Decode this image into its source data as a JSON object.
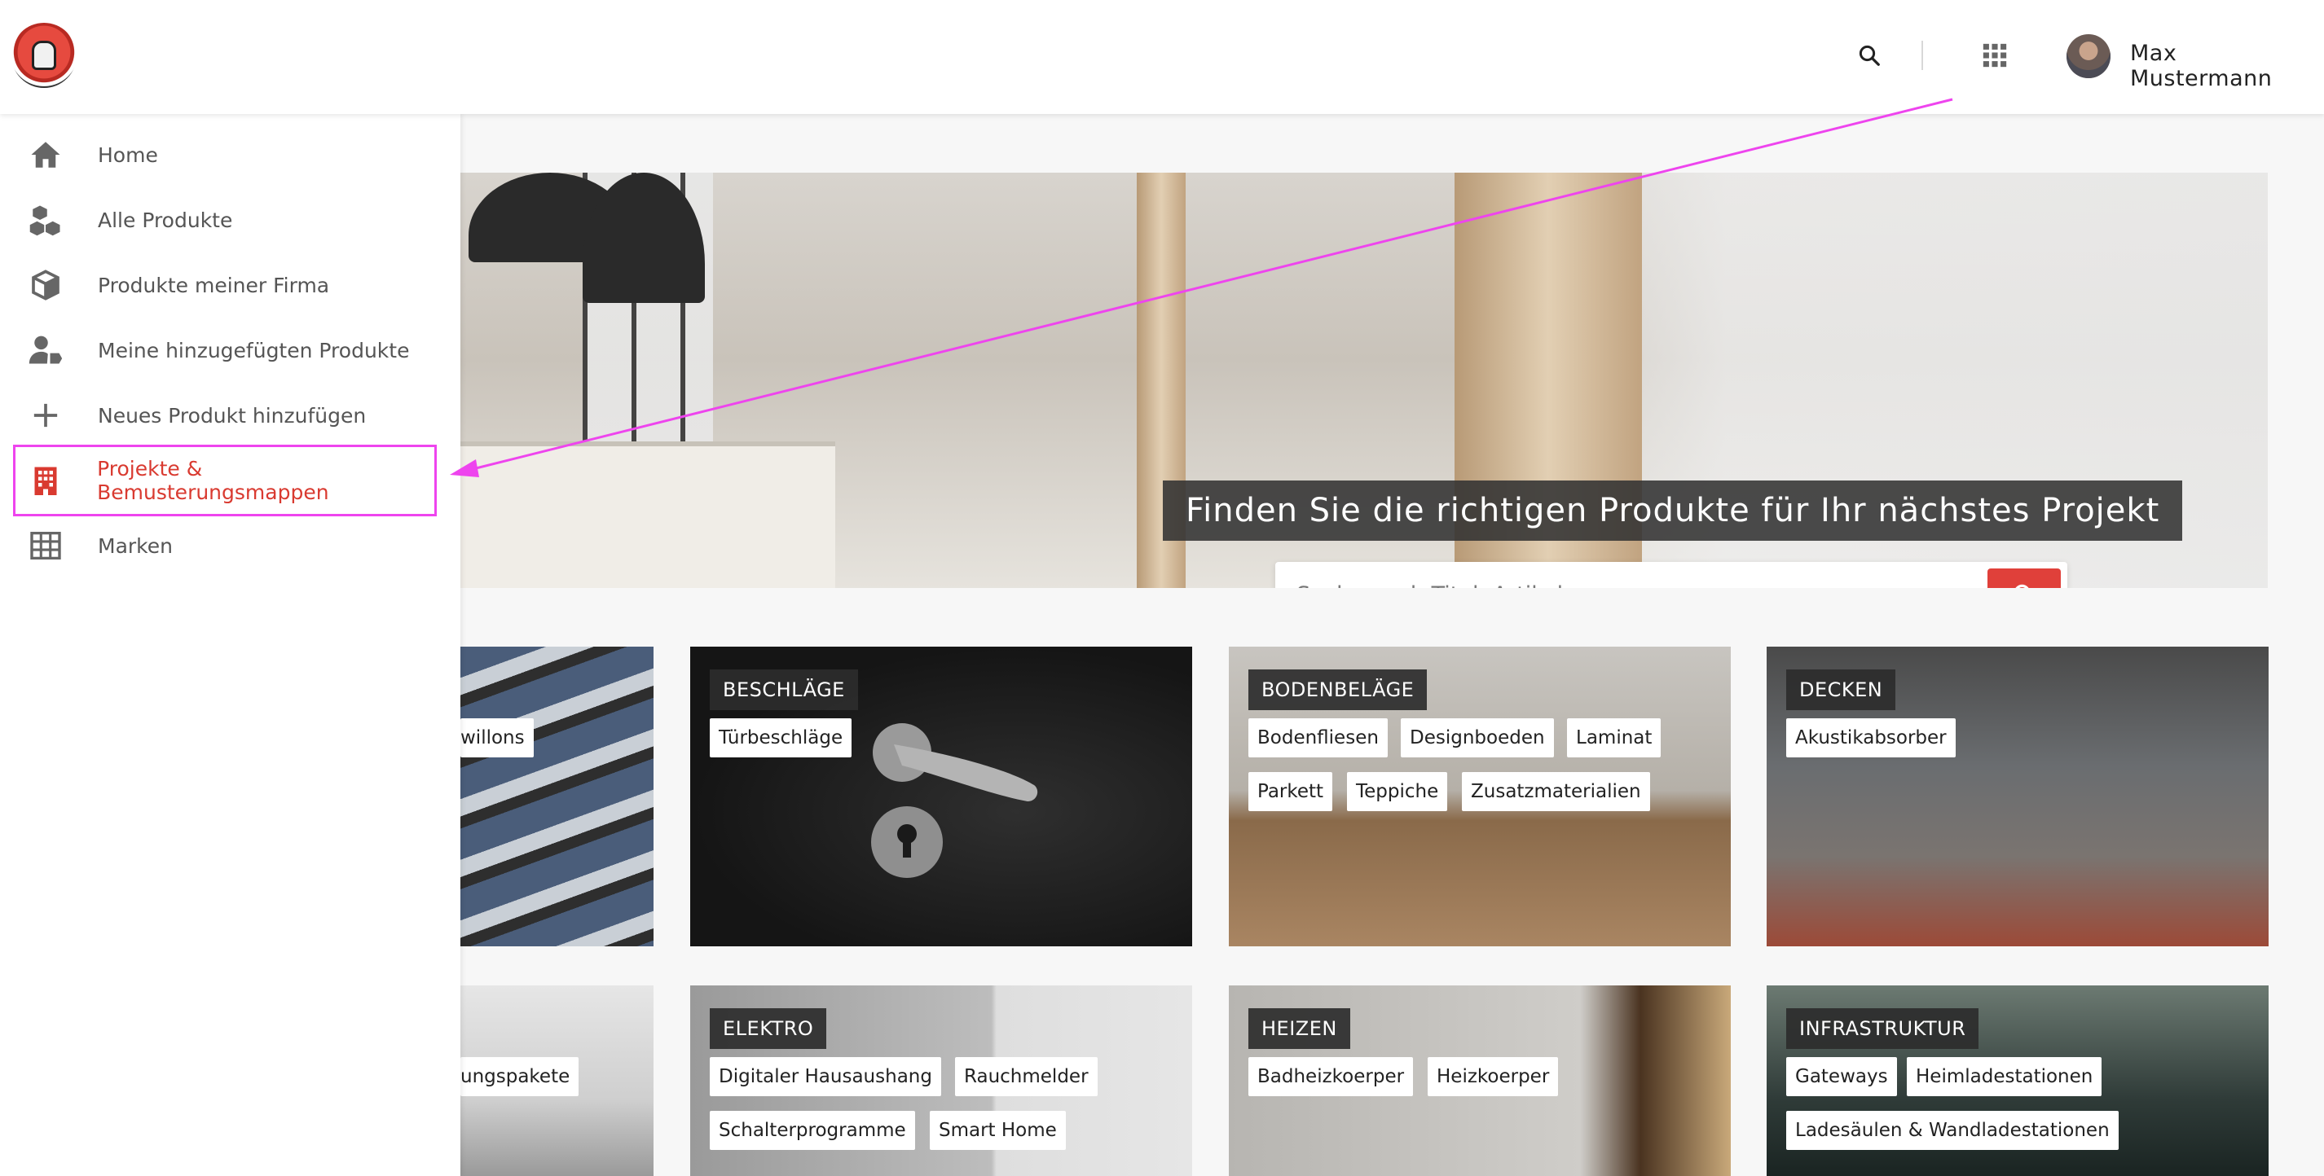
{
  "header": {
    "username": "Max Mustermann"
  },
  "sidebar": {
    "items": [
      {
        "label": "Home",
        "icon": "home-icon"
      },
      {
        "label": "Alle Produkte",
        "icon": "boxes-icon"
      },
      {
        "label": "Produkte meiner Firma",
        "icon": "box-icon"
      },
      {
        "label": "Meine hinzugefügten Produkte",
        "icon": "user-tag-icon"
      },
      {
        "label": "Neues Produkt hinzufügen",
        "icon": "plus-icon"
      },
      {
        "label": "Projekte & Bemusterungsmappen",
        "icon": "building-icon",
        "active": true
      },
      {
        "label": "Marken",
        "icon": "grid-icon"
      }
    ]
  },
  "hero": {
    "title": "Finden Sie die richtigen Produkte für Ihr nächstes Projekt",
    "search_placeholder": "Suche nach Titel, Artikelnummer"
  },
  "categories": {
    "a1": {
      "tags": [
        "willons"
      ]
    },
    "a2": {
      "tags": [
        "ungspakete"
      ]
    },
    "beschlaege": {
      "title": "BESCHLÄGE",
      "tags": [
        "Türbeschläge"
      ]
    },
    "bodenbelaege": {
      "title": "BODENBELÄGE",
      "tags": [
        "Bodenfliesen",
        "Designboeden",
        "Laminat",
        "Parkett",
        "Teppiche",
        "Zusatzmaterialien"
      ]
    },
    "decken": {
      "title": "DECKEN",
      "tags": [
        "Akustikabsorber"
      ]
    },
    "elektro": {
      "title": "ELEKTRO",
      "tags": [
        "Digitaler Hausaushang",
        "Rauchmelder",
        "Schalterprogramme",
        "Smart Home"
      ]
    },
    "heizen": {
      "title": "HEIZEN",
      "tags": [
        "Badheizkoerper",
        "Heizkoerper"
      ]
    },
    "infrastruktur": {
      "title": "INFRASTRUKTUR",
      "tags": [
        "Gateways",
        "Heimladestationen",
        "Ladesäulen & Wandladestationen"
      ]
    }
  },
  "colors": {
    "accent": "#e0403a",
    "annotation": "#ee44ee",
    "active_nav": "#d93a30"
  }
}
